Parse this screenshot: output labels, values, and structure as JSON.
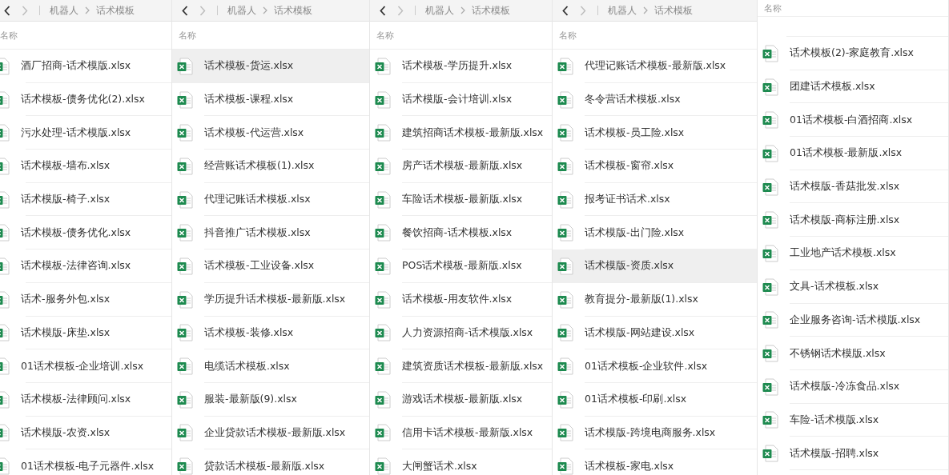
{
  "panels": [
    {
      "breadcrumb": [
        "机器人",
        "话术模板"
      ],
      "column_header": "名称",
      "files": [
        {
          "name": "酒厂招商-话术模版.xlsx",
          "selected": false
        },
        {
          "name": "话术模板-债务优化(2).xlsx",
          "selected": false
        },
        {
          "name": "污水处理-话术模版.xlsx",
          "selected": false
        },
        {
          "name": "话术模板-墙布.xlsx",
          "selected": false
        },
        {
          "name": "话术模版-椅子.xlsx",
          "selected": false
        },
        {
          "name": "话术模板-债务优化.xlsx",
          "selected": false
        },
        {
          "name": "话术模板-法律咨询.xlsx",
          "selected": false
        },
        {
          "name": "话术-服务外包.xlsx",
          "selected": false
        },
        {
          "name": "话术模版-床垫.xlsx",
          "selected": false
        },
        {
          "name": "01话术模板-企业培训.xlsx",
          "selected": false
        },
        {
          "name": "话术模板-法律顾问.xlsx",
          "selected": false
        },
        {
          "name": "话术模版-农资.xlsx",
          "selected": false
        },
        {
          "name": "01话术模板-电子元器件.xlsx",
          "selected": false
        }
      ]
    },
    {
      "breadcrumb": [
        "机器人",
        "话术模板"
      ],
      "column_header": "名称",
      "files": [
        {
          "name": "话术模板-货运.xlsx",
          "selected": true
        },
        {
          "name": "话术模板-课程.xlsx",
          "selected": false
        },
        {
          "name": "话术模板-代运营.xlsx",
          "selected": false
        },
        {
          "name": "经营账话术模板(1).xlsx",
          "selected": false
        },
        {
          "name": "代理记账话术模板.xlsx",
          "selected": false
        },
        {
          "name": "抖音推广话术模板.xlsx",
          "selected": false
        },
        {
          "name": "话术模板-工业设备.xlsx",
          "selected": false
        },
        {
          "name": "学历提升话术模板-最新版.xlsx",
          "selected": false
        },
        {
          "name": "话术模板-装修.xlsx",
          "selected": false
        },
        {
          "name": "电缆话术模板.xlsx",
          "selected": false
        },
        {
          "name": "服装-最新版(9).xlsx",
          "selected": false
        },
        {
          "name": "企业贷款话术模板-最新版.xlsx",
          "selected": false
        },
        {
          "name": "贷款话术模板-最新版.xlsx",
          "selected": false
        }
      ]
    },
    {
      "breadcrumb": [
        "机器人",
        "话术模板"
      ],
      "column_header": "名称",
      "files": [
        {
          "name": "话术模板-学历提升.xlsx",
          "selected": false
        },
        {
          "name": "话术模版-会计培训.xlsx",
          "selected": false
        },
        {
          "name": "建筑招商话术模板-最新版.xlsx",
          "selected": false
        },
        {
          "name": "房产话术模板-最新版.xlsx",
          "selected": false
        },
        {
          "name": "车险话术模板-最新版.xlsx",
          "selected": false
        },
        {
          "name": "餐饮招商-话术模板.xlsx",
          "selected": false
        },
        {
          "name": "POS话术模板-最新版.xlsx",
          "selected": false
        },
        {
          "name": "话术模板-用友软件.xlsx",
          "selected": false
        },
        {
          "name": "人力资源招商-话术模版.xlsx",
          "selected": false
        },
        {
          "name": "建筑资质话术模板-最新版.xlsx",
          "selected": false
        },
        {
          "name": "游戏话术模板-最新版.xlsx",
          "selected": false
        },
        {
          "name": "信用卡话术模板-最新版.xlsx",
          "selected": false
        },
        {
          "name": "大闸蟹话术.xlsx",
          "selected": false
        }
      ]
    },
    {
      "breadcrumb": [
        "机器人",
        "话术模板"
      ],
      "column_header": "名称",
      "files": [
        {
          "name": "代理记账话术模板-最新版.xlsx",
          "selected": false
        },
        {
          "name": "冬令营话术模板.xlsx",
          "selected": false
        },
        {
          "name": "话术模板-员工险.xlsx",
          "selected": false
        },
        {
          "name": "话术模板-窗帘.xlsx",
          "selected": false
        },
        {
          "name": "报考证书话术.xlsx",
          "selected": false
        },
        {
          "name": "话术模版-出门险.xlsx",
          "selected": false
        },
        {
          "name": "话术模版-资质.xlsx",
          "selected": true
        },
        {
          "name": "教育提分-最新版(1).xlsx",
          "selected": false
        },
        {
          "name": "话术模版-网站建设.xlsx",
          "selected": false
        },
        {
          "name": "01话术模板-企业软件.xlsx",
          "selected": false
        },
        {
          "name": "01话术模板-印刷.xlsx",
          "selected": false
        },
        {
          "name": "话术模版-跨境电商服务.xlsx",
          "selected": false
        },
        {
          "name": "话术模板-家电.xlsx",
          "selected": false
        }
      ]
    },
    {
      "column_header": "名称",
      "files": [
        {
          "name": "话术模板(2)-家庭教育.xlsx",
          "selected": false
        },
        {
          "name": "团建话术模板.xlsx",
          "selected": false
        },
        {
          "name": "01话术模板-白酒招商.xlsx",
          "selected": false
        },
        {
          "name": "01话术模板-最新版.xlsx",
          "selected": false
        },
        {
          "name": "话术模版-香菇批发.xlsx",
          "selected": false
        },
        {
          "name": "话术模版-商标注册.xlsx",
          "selected": false
        },
        {
          "name": "工业地产话术模板.xlsx",
          "selected": false
        },
        {
          "name": "文具-话术模板.xlsx",
          "selected": false
        },
        {
          "name": "企业服务咨询-话术模版.xlsx",
          "selected": false
        },
        {
          "name": "不锈钢话术模版.xlsx",
          "selected": false
        },
        {
          "name": "话术模版-冷冻食品.xlsx",
          "selected": false
        },
        {
          "name": "车险-话术模版.xlsx",
          "selected": false
        },
        {
          "name": "话术模版-招聘.xlsx",
          "selected": false
        }
      ]
    }
  ]
}
